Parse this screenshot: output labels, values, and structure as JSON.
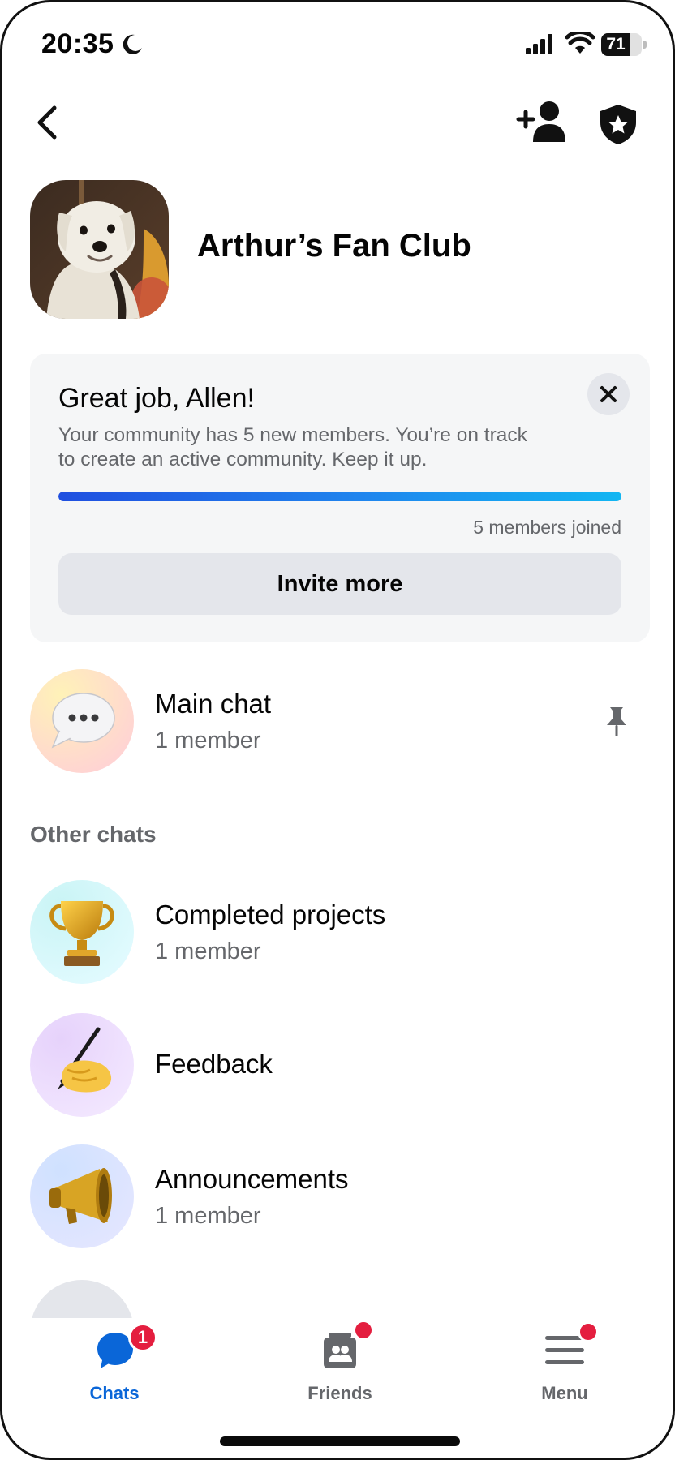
{
  "status_bar": {
    "time": "20:35",
    "battery_level": "71",
    "battery_fraction": 0.71
  },
  "header": {
    "group_title": "Arthur’s Fan Club",
    "icons": [
      "back-arrow-icon",
      "add-member-icon",
      "admin-shield-icon"
    ]
  },
  "progress_card": {
    "title": "Great job, Allen!",
    "description": "Your community has 5 new members. You’re on track to create an active community. Keep it up.",
    "progress_fraction": 1.0,
    "progress_label": "5 members joined",
    "invite_button": "Invite more",
    "bar_colors": [
      "#1f4fe0",
      "#12b6f2"
    ]
  },
  "main_chat": {
    "name": "Main chat",
    "members": "1 member",
    "icon": "speech-bubble-icon",
    "pinned": true
  },
  "other_chats": {
    "label": "Other chats",
    "items": [
      {
        "name": "Completed projects",
        "members": "1 member",
        "icon": "trophy-icon"
      },
      {
        "name": "Feedback",
        "members": "",
        "icon": "writing-hand-icon"
      },
      {
        "name": "Announcements",
        "members": "1 member",
        "icon": "megaphone-icon"
      }
    ]
  },
  "bottom_nav": {
    "items": [
      {
        "label": "Chats",
        "badge": "1",
        "active": true
      },
      {
        "label": "Friends",
        "badge": "",
        "active": false
      },
      {
        "label": "Menu",
        "badge": "",
        "active": false
      }
    ]
  },
  "colors": {
    "accent": "#0a66d8",
    "badge": "#e41e3f",
    "secondary_text": "#65676b",
    "card_bg": "#f5f6f7"
  }
}
